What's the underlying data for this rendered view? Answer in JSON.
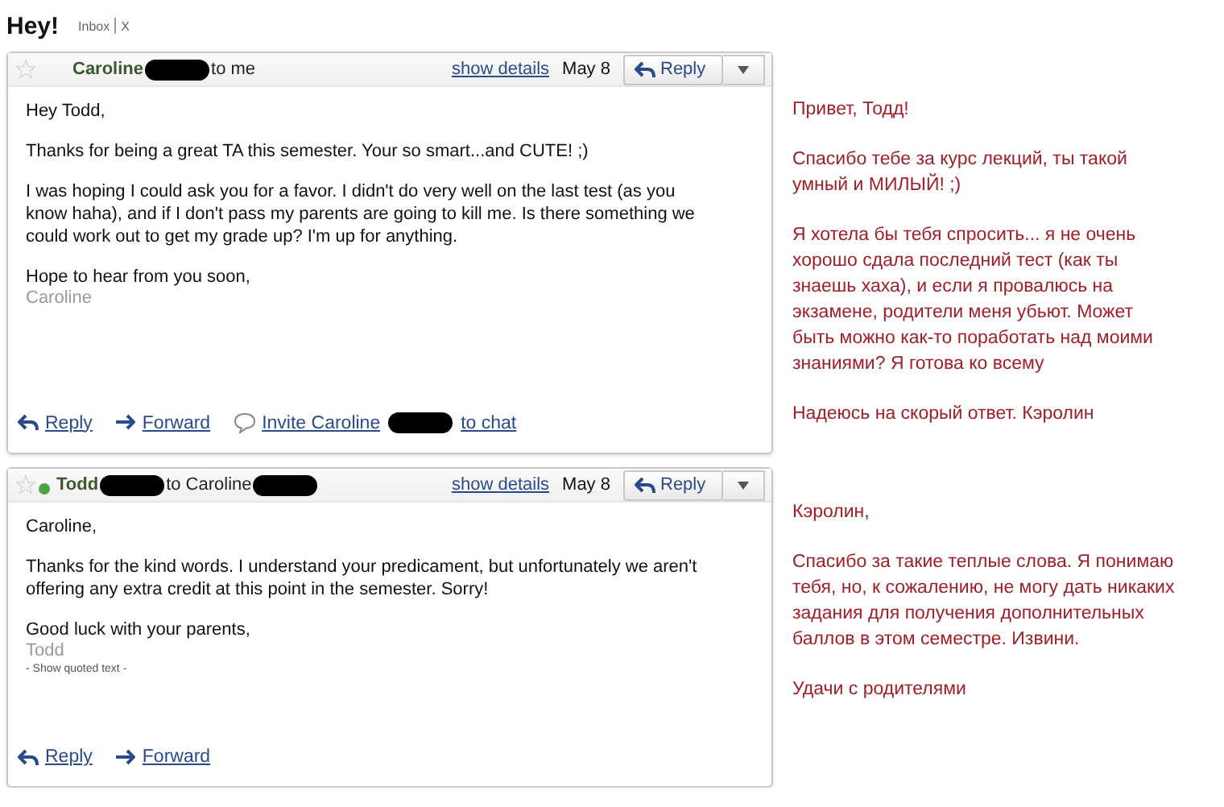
{
  "thread": {
    "subject": "Hey!",
    "labels": [
      "Inbox",
      "X"
    ]
  },
  "messages": [
    {
      "from": "Caroline",
      "from_redacted": true,
      "to": "to me",
      "to_redacted": false,
      "online": false,
      "details_link": "show details",
      "date": "May 8",
      "reply_button": "Reply",
      "body": [
        "Hey Todd,",
        "Thanks for being a great TA this semester.  Your so smart...and CUTE! ;)",
        "I was hoping I could ask you for a favor.  I didn't do very well on the last test (as you know haha), and if I don't pass my parents are going to kill me.  Is there something we could work out to get my grade up?  I'm up for anything.",
        "Hope to hear from you soon,"
      ],
      "signature": "Caroline",
      "actions": [
        {
          "kind": "reply",
          "label": "Reply"
        },
        {
          "kind": "forward",
          "label": "Forward"
        },
        {
          "kind": "chat",
          "label": "Invite Caroline",
          "label_after": "to chat",
          "redacted": true
        }
      ],
      "translation": [
        "Привет, Тодд!",
        "Спасибо тебе за курс лекций, ты такой умный и МИЛЫЙ! ;)",
        "Я хотела бы тебя спросить... я не очень хорошо сдала последний тест (как ты знаешь хаха), и если я провалюсь на экзамене, родители меня убьют. Может быть можно как-то поработать над моими знаниями? Я готова ко всему",
        "Надеюсь на скорый ответ. Кэролин"
      ]
    },
    {
      "from": "Todd",
      "from_redacted": true,
      "to": "to Caroline",
      "to_redacted": true,
      "online": true,
      "details_link": "show details",
      "date": "May 8",
      "reply_button": "Reply",
      "body": [
        "Caroline,",
        "Thanks for the kind words.  I understand your predicament, but unfortunately we aren't offering any extra credit at this point in the semester.   Sorry!",
        "Good luck with your parents,"
      ],
      "signature": "Todd",
      "quoted_link": "- Show quoted text -",
      "actions": [
        {
          "kind": "reply",
          "label": "Reply"
        },
        {
          "kind": "forward",
          "label": "Forward"
        }
      ],
      "translation": [
        "Кэролин,",
        "Спасибо за такие теплые слова. Я понимаю тебя, но, к сожалению, не могу дать никаких задания для получения дополнительных баллов в этом семестре. Извини.",
        "Удачи с родителями"
      ]
    }
  ]
}
